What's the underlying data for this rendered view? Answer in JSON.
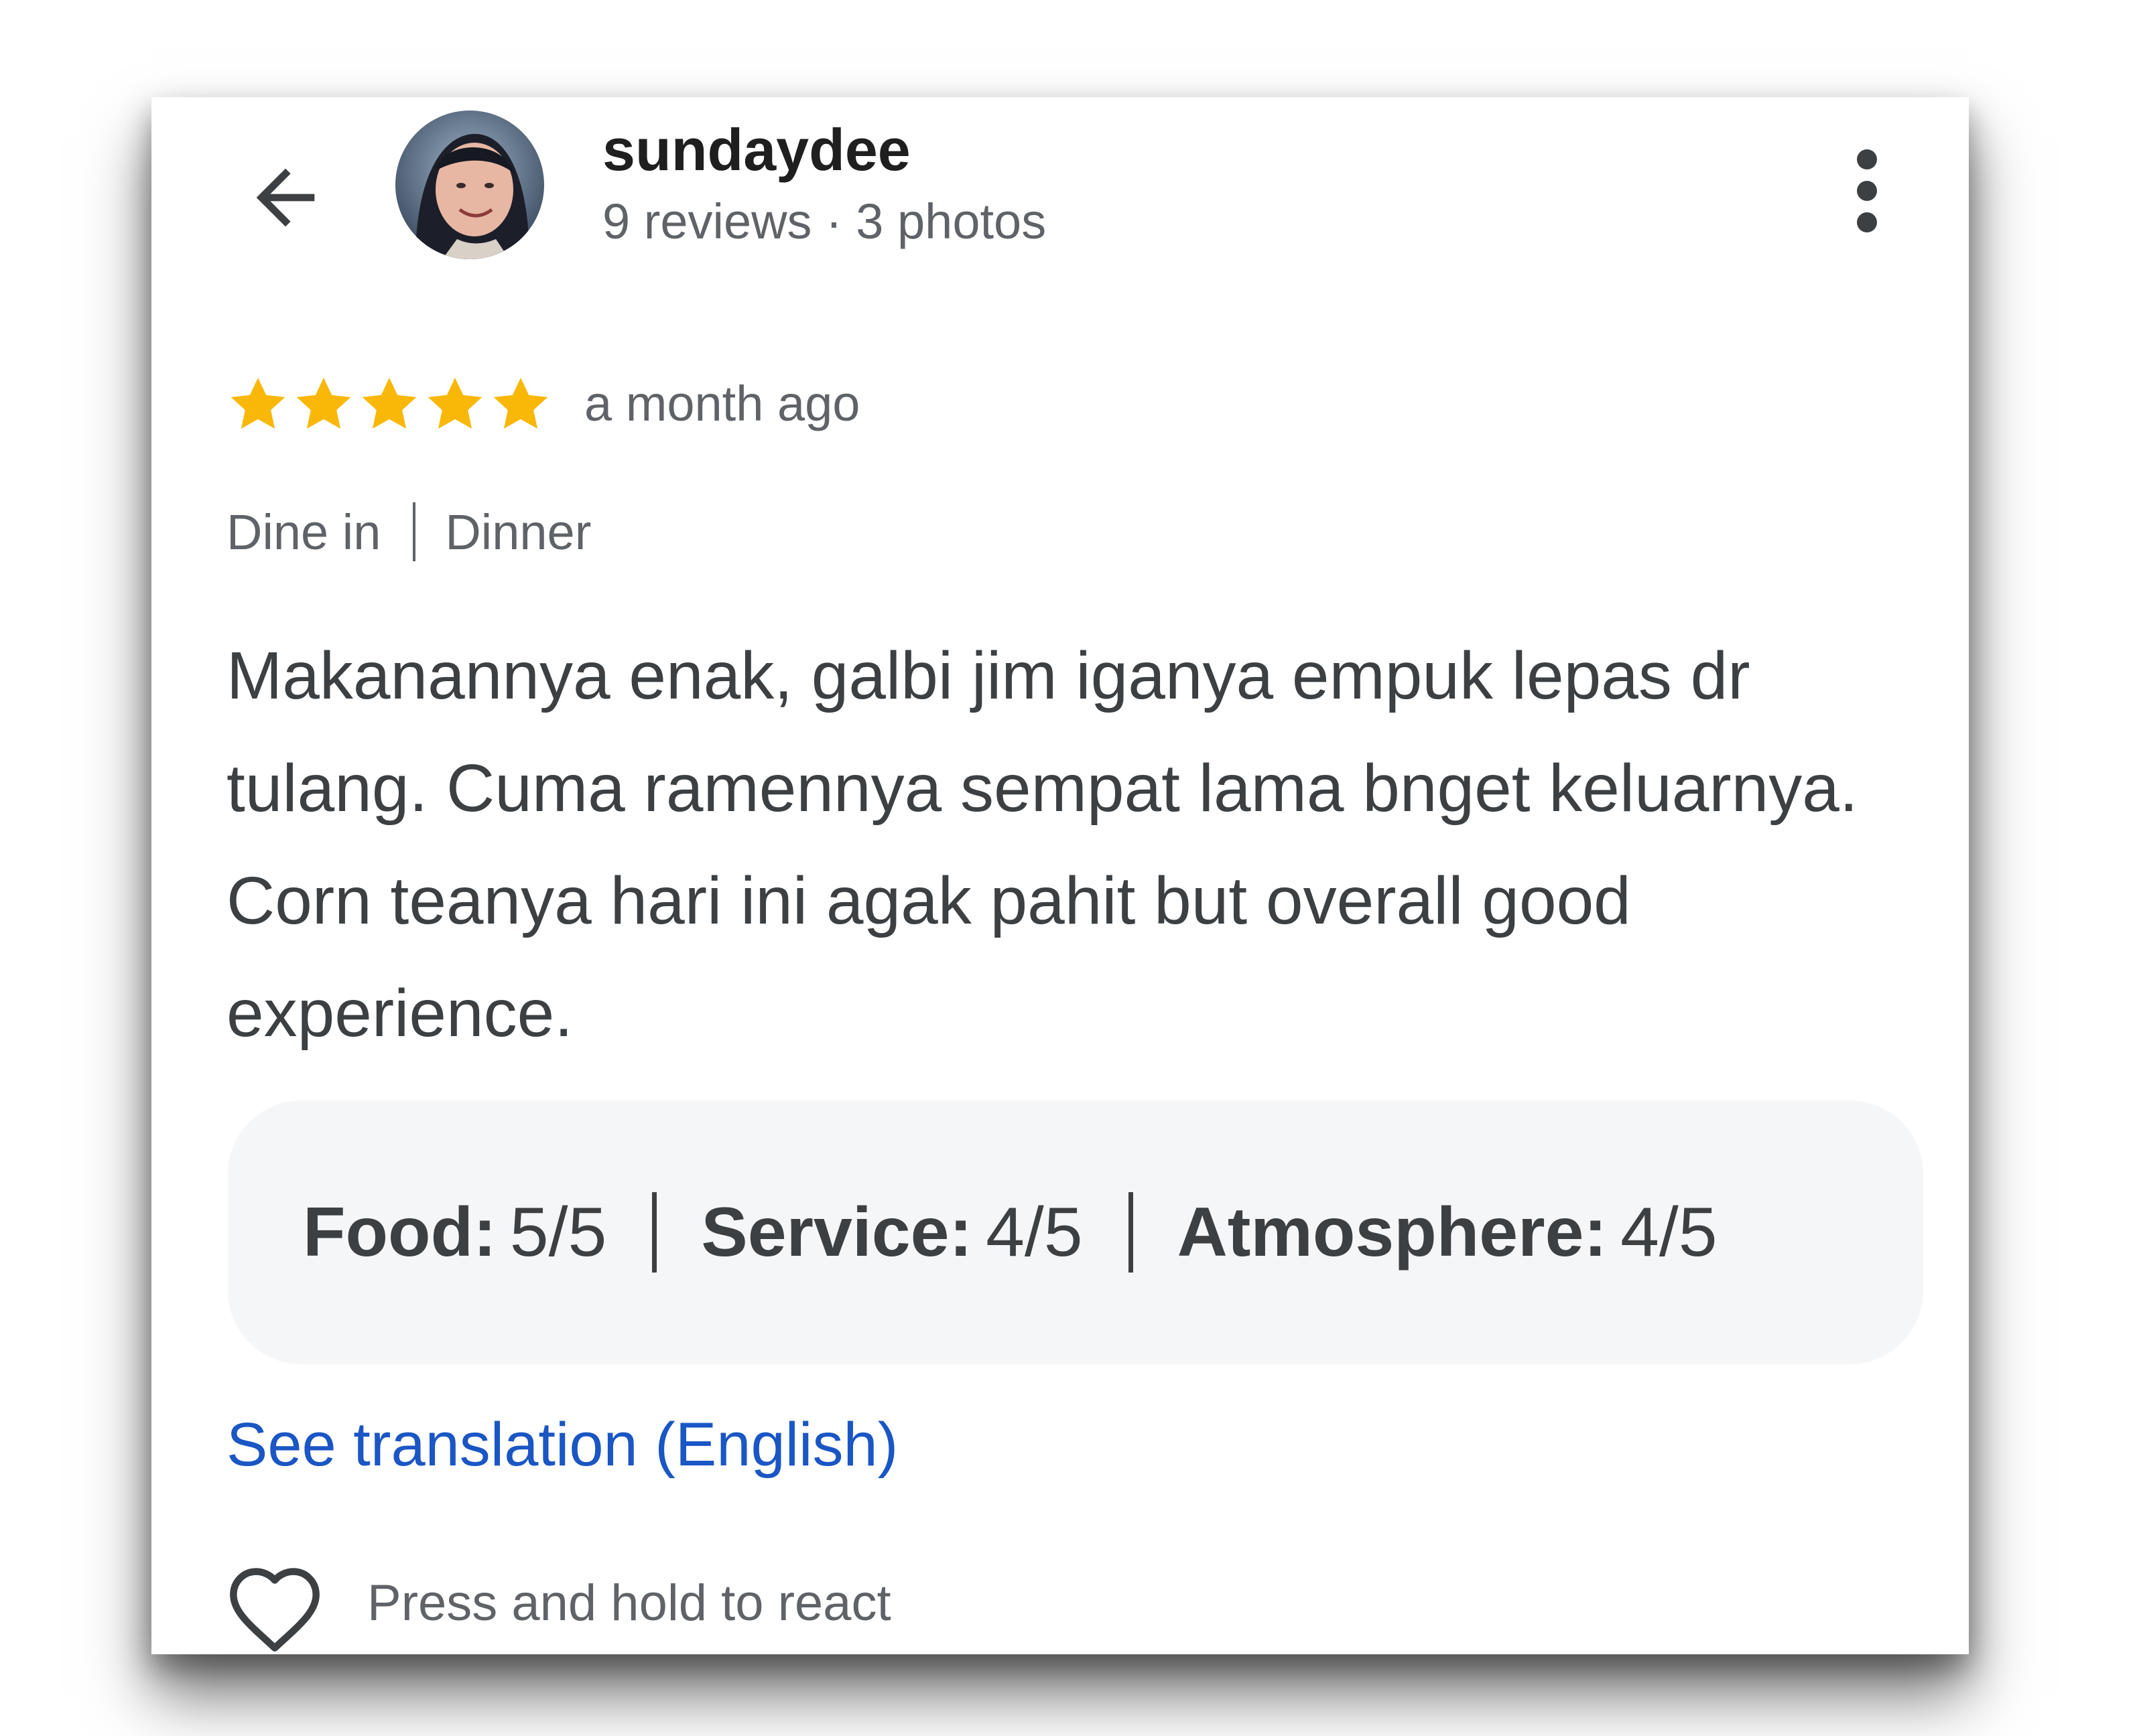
{
  "header": {
    "back_icon": "arrow-left-icon",
    "avatar_icon": "user-avatar-photo",
    "user_name": "sundaydee",
    "user_meta": "9 reviews · 3 photos",
    "more_icon": "more-vert-icon"
  },
  "review": {
    "rating": 5,
    "max_rating": 5,
    "star_color": "#f9b707",
    "time_ago": "a month ago",
    "tags": [
      "Dine in",
      "Dinner"
    ],
    "text": "Makanannya enak, galbi jim iganya empuk lepas dr tulang. Cuma ramennya sempat lama bnget keluarnya. Corn teanya hari ini agak pahit but overall good experience.",
    "sub_ratings": [
      {
        "label": "Food:",
        "value": "5/5"
      },
      {
        "label": "Service:",
        "value": "4/5"
      },
      {
        "label": "Atmosphere:",
        "value": "4/5"
      }
    ],
    "translation_link": "See translation (English)",
    "link_color": "#1a56c4",
    "react_icon": "heart-outline-icon",
    "react_hint": "Press and hold to react"
  }
}
